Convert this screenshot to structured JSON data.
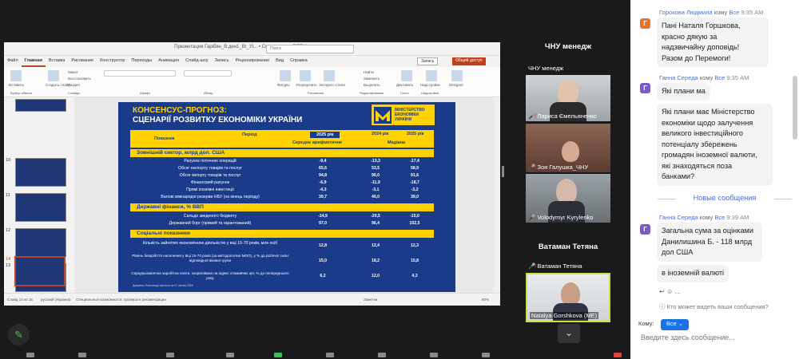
{
  "ppt": {
    "window_title": "Презентация Гарібян_В.ден1_ВІ_УІ... • Сохранено в: ППТ/Консенсус •",
    "search_placeholder": "Поиск",
    "menu": [
      "Файл",
      "Главная",
      "Вставка",
      "Рисование",
      "Конструктор",
      "Переходы",
      "Анимация",
      "Слайд-шоу",
      "Запись",
      "Рецензирование",
      "Вид",
      "Справка"
    ],
    "share_label": "Запись",
    "access_label": "Общий доступ",
    "ribbon_labels": [
      "Вставить",
      "Создать слайд",
      "Макет",
      "Восстановить",
      "Раздел",
      "Шрифт",
      "Абзац",
      "Фигуры",
      "Упорядочить",
      "Экспресс-стили",
      "Найти",
      "Заменить",
      "Выделить",
      "Диктовать",
      "Надстройки",
      "Designer"
    ],
    "ribbon_groups": [
      "Буфер обмена",
      "Слайды",
      "Шрифт",
      "Абзац",
      "Рисование",
      "Редактирование",
      "Голос",
      "Надстройки"
    ],
    "thumb_numbers": [
      "10",
      "11",
      "12",
      "13",
      "14"
    ],
    "status": {
      "slide": "Слайд 14 из 15",
      "lang": "русский (Украина)",
      "notes": "Специальные возможности: проверьте рекомендации",
      "notes_btn": "Заметки",
      "zoom": "80%"
    }
  },
  "slide": {
    "title1": "КОНСЕНСУС-ПРОГНОЗ:",
    "title2": "СЦЕНАРІЇ РОЗВИТКУ ЕКОНОМІКИ УКРАЇНИ",
    "logo_text": [
      "МІНІСТЕРСТВО",
      "ЕКОНОМІКИ",
      "УКРАЇНИ"
    ],
    "header": {
      "indicator": "Показник",
      "period": "Період",
      "y2025": "2025 рік",
      "y2024": "2024 рік",
      "y2025b": "2025 рік",
      "avg": "Середнє арифметичне",
      "median": "Медіана"
    },
    "sections": [
      {
        "title": "Зовнішній сектор, млрд дол. США",
        "rows": [
          {
            "label": "Рахунок поточних операцій",
            "v1": "-9,4",
            "v2": "-13,3",
            "v3": "-17,4"
          },
          {
            "label": "Обсяг експорту товарів та послуг",
            "v1": "65,6",
            "v2": "53,5",
            "v3": "58,9"
          },
          {
            "label": "Обсяг імпорту товарів та послуг",
            "v1": "94,8",
            "v2": "90,0",
            "v3": "91,6"
          },
          {
            "label": "Фінансовий рахунок",
            "v1": "-6,9",
            "v2": "-11,9",
            "v3": "-18,7"
          },
          {
            "label": "Прямі іноземні інвестиції",
            "v1": "-4,3",
            "v2": "-3,1",
            "v3": "-3,2"
          },
          {
            "label": "Валові міжнародні резерви НБУ (на кінець періоду)",
            "v1": "39,7",
            "v2": "40,0",
            "v3": "39,0"
          }
        ]
      },
      {
        "title": "Державні фінанси, % ВВП",
        "rows": [
          {
            "label": "Сальдо зведеного бюджету",
            "v1": "-14,9",
            "v2": "-20,5",
            "v3": "-15,0"
          },
          {
            "label": "Державний борг (прямий та гарантований)",
            "v1": "97,0",
            "v2": "96,4",
            "v3": "102,5"
          }
        ]
      },
      {
        "title": "Соціальні показники",
        "rows": [
          {
            "label": "Кількість зайнятих економічною діяльністю у віці 15-70 років, млн осіб",
            "v1": "12,8",
            "v2": "12,4",
            "v3": "12,3"
          },
          {
            "label": "Рівень безробіття населення у віці 15-70 років (за методологією МОП), у % до робочої сили відповідної вікової групи",
            "v1": "15,0",
            "v2": "18,2",
            "v3": "15,8"
          },
          {
            "label": "Середньомісячна заробітна плата, скоригована на індекс споживчих цін, % до попереднього року",
            "v1": "6,2",
            "v2": "12,0",
            "v3": "4,3"
          }
        ]
      }
    ],
    "footnote": "Джерело: Консенсус-прогноз за 07 квітня 2024"
  },
  "participants": [
    {
      "kind": "name",
      "big": "ЧНУ менедж",
      "label": "ЧНУ менедж"
    },
    {
      "kind": "video",
      "label": "Лариса Ємельяненко",
      "muted": true
    },
    {
      "kind": "video",
      "label": "Зоя Галушка_ЧНУ",
      "muted": true
    },
    {
      "kind": "video",
      "label": "Volodymyr Kyrylenko",
      "muted": true
    },
    {
      "kind": "name",
      "big": "Ватаман Тетяна",
      "label": "Ватаман Тетяна",
      "muted": true
    },
    {
      "kind": "video",
      "label": "Natalya Gorshkova (ME)",
      "muted": false
    }
  ],
  "chat": {
    "messages": [
      {
        "from": "Горохова Людмила",
        "to": "кому",
        "all": "Все",
        "time": "9:35 AM",
        "avatar": "Г",
        "avatar_color": "#e8742a",
        "lines": [
          "Пані Наталя Горшкова,",
          "красно дякую за",
          "надзвичайну доповідь!",
          "Разом до Перемоги!"
        ]
      },
      {
        "from": "Ганна Середа",
        "to": "кому",
        "all": "Все",
        "time": "9:35 AM",
        "avatar": "Г",
        "avatar_color": "#7a5ac8",
        "lines": [
          "Які плани ма"
        ]
      },
      {
        "lines": [
          "Які плани має Міністерство",
          "економіки щодо залучення",
          "великого інвестиційного",
          "потенціалу збережень",
          "громадян іноземної валюти,",
          "які знаходяться  поза",
          "банками?"
        ]
      },
      {
        "from": "Ганна Середа",
        "to": "кому",
        "all": "Все",
        "time": "9:39 AM",
        "avatar": "Г",
        "avatar_color": "#7a5ac8",
        "lines": [
          "Загальна сума за оцінками",
          "Данилишина Б. - 118 млрд",
          "дол США"
        ]
      },
      {
        "lines": [
          "в іноземній валюті"
        ]
      }
    ],
    "new_messages": "Новые сообщения",
    "who_typing": "Кто может видеть ваши сообщения?",
    "to_label": "Кому:",
    "to_value": "Все",
    "input_placeholder": "Введите здесь сообщение..."
  },
  "icons": {
    "pen": "pen-icon",
    "chevron": "chevron-down-icon",
    "mic_off": "mic-off-icon"
  }
}
